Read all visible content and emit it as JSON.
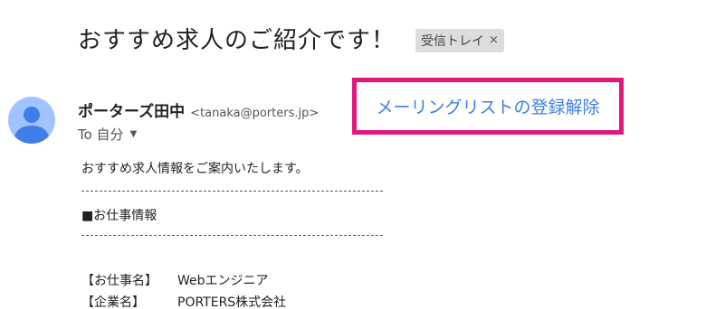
{
  "email": {
    "subject": "おすすめ求人のご紹介です！",
    "label": "受信トレイ",
    "label_remove": "×",
    "sender": {
      "name": "ポーターズ田中",
      "email": "<tanaka@porters.jp>",
      "avatar_icon": "person-icon"
    },
    "to": {
      "label": "To 自分",
      "caret_icon": "caret-down-icon"
    },
    "unsubscribe": {
      "label": "メーリングリストの登録解除",
      "highlight_color": "#e0177f",
      "link_color": "#3d7fe3"
    },
    "body": {
      "intro": "おすすめ求人情報をご案内いたします。",
      "section_title": "■お仕事情報",
      "fields": [
        {
          "key": "【お仕事名】",
          "value": "Webエンジニア"
        },
        {
          "key": "【企業名】",
          "value": "PORTERS株式会社"
        }
      ]
    }
  }
}
